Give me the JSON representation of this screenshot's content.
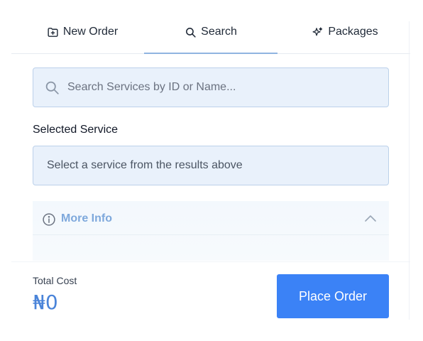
{
  "tabs": [
    {
      "label": "New Order",
      "icon": "folder-plus-icon"
    },
    {
      "label": "Search",
      "icon": "search-icon",
      "active": true
    },
    {
      "label": "Packages",
      "icon": "sparkles-icon"
    }
  ],
  "search": {
    "placeholder": "Search Services by ID or Name...",
    "value": ""
  },
  "selected_service": {
    "label": "Selected Service",
    "placeholder_text": "Select a service from the results above"
  },
  "more_info": {
    "label": "More Info",
    "icon": "info-icon",
    "toggle_icon": "chevron-up-icon"
  },
  "footer": {
    "total_label": "Total Cost",
    "total_value": "₦0",
    "place_order_label": "Place Order"
  },
  "colors": {
    "accent": "#3b82f6",
    "input_bg": "#e9f1fb",
    "input_border": "#bcd1ea",
    "more_info_text": "#7ea8dc",
    "total_value": "#4a84d9"
  }
}
